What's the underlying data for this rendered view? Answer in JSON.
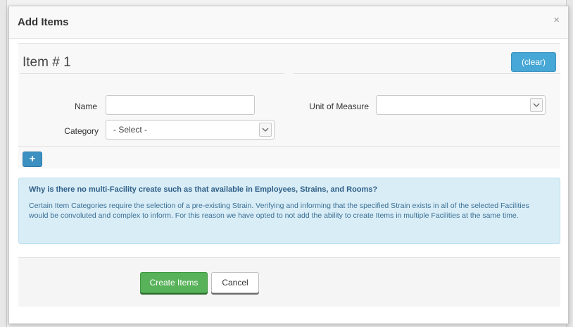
{
  "modal": {
    "title": "Add Items",
    "close_glyph": "×"
  },
  "item": {
    "title": "Item # 1",
    "clear_label": "(clear)",
    "add_glyph": "+",
    "fields": {
      "name_label": "Name",
      "name_value": "",
      "category_label": "Category",
      "category_selected": "- Select -",
      "unit_label": "Unit of Measure",
      "unit_selected": ""
    }
  },
  "info": {
    "heading": "Why is there no multi-Facility create such as that available in Employees, Strains, and Rooms?",
    "body": "Certain Item Categories require the selection of a pre-existing Strain. Verifying and informing that the specified Strain exists in all of the selected Facilities would be convoluted and complex to inform. For this reason we have opted to not add the ability to create Items in multiple Facilities at the same time."
  },
  "footer": {
    "create_label": "Create Items",
    "cancel_label": "Cancel"
  },
  "icons": {
    "close": "close-icon",
    "dropdown": "chevron-down-icon",
    "add": "plus-icon"
  },
  "colors": {
    "primary_blue": "#47a7d6",
    "add_blue": "#3c8fc1",
    "info_bg": "#d9edf7",
    "success_green": "#58b25a"
  }
}
